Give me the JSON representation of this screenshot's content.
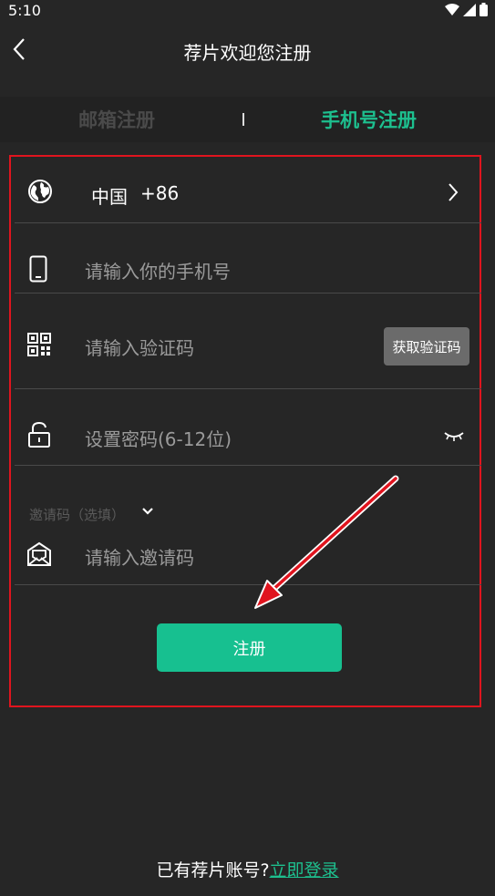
{
  "status": {
    "time": "5:10"
  },
  "header": {
    "title": "荐片欢迎您注册"
  },
  "tabs": {
    "email": "邮箱注册",
    "phone": "手机号注册",
    "active": "phone"
  },
  "form": {
    "country": {
      "name": "中国",
      "code": "+86"
    },
    "phone_placeholder": "请输入你的手机号",
    "code_placeholder": "请输入验证码",
    "get_code_label": "获取验证码",
    "password_placeholder": "设置密码(6-12位)",
    "invite_label": "邀请码（选填）",
    "invite_placeholder": "请输入邀请码",
    "register_label": "注册"
  },
  "footer": {
    "prompt": "已有荐片账号?",
    "login_link": "立即登录"
  },
  "colors": {
    "accent": "#1dc08f",
    "background": "#262626",
    "highlight_box": "#e0141e",
    "arrow": "#e0141e"
  }
}
